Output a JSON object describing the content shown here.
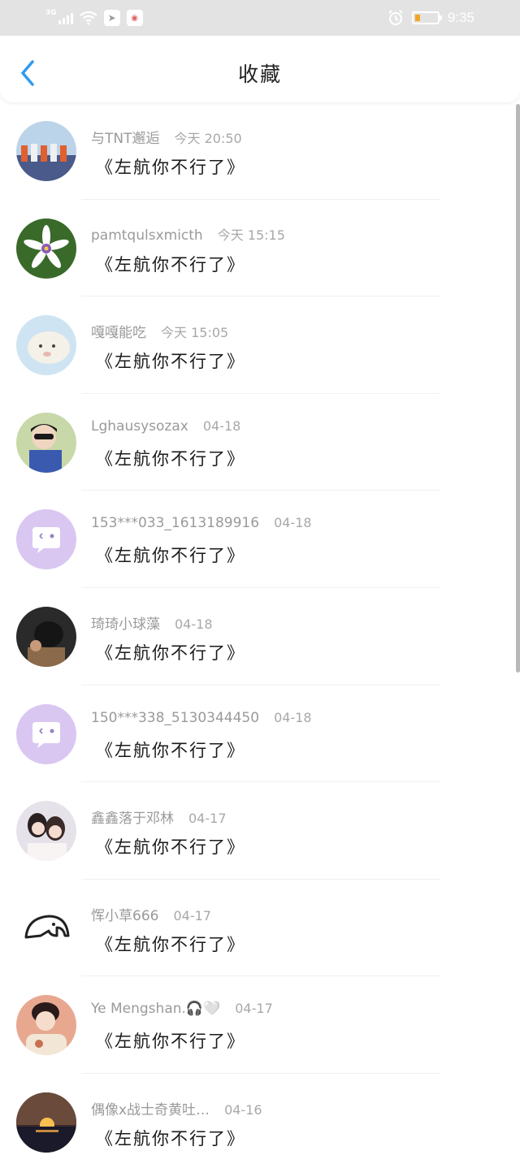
{
  "status_bar": {
    "network_label": "3G",
    "time": "9:35",
    "battery_color": "#f0a623"
  },
  "header": {
    "title": "收藏",
    "back_icon": "chevron-left-icon",
    "accent_color": "#2f9bf0"
  },
  "favorites": [
    {
      "user": "与TNT邂逅",
      "time": "今天 20:50",
      "content": "《左航你不行了》",
      "avatar": "group-photo"
    },
    {
      "user": "pamtqulsxmicth",
      "time": "今天 15:15",
      "content": "《左航你不行了》",
      "avatar": "flower"
    },
    {
      "user": "嘎嘎能吃",
      "time": "今天 15:05",
      "content": "《左航你不行了》",
      "avatar": "lamb"
    },
    {
      "user": "Lghausysozax",
      "time": "04-18",
      "content": "《左航你不行了》",
      "avatar": "boy-sunglasses"
    },
    {
      "user": "153***033_1613189916",
      "time": "04-18",
      "content": "《左航你不行了》",
      "avatar": "default-chat"
    },
    {
      "user": "琦琦小球藻",
      "time": "04-18",
      "content": "《左航你不行了》",
      "avatar": "dark-portrait"
    },
    {
      "user": "150***338_5130344450",
      "time": "04-18",
      "content": "《左航你不行了》",
      "avatar": "default-chat"
    },
    {
      "user": "鑫鑫落于邓林",
      "time": "04-17",
      "content": "《左航你不行了》",
      "avatar": "two-girls"
    },
    {
      "user": "恽小草666",
      "time": "04-17",
      "content": "《左航你不行了》",
      "avatar": "elephant-line"
    },
    {
      "user": "Ye Mengshan.🎧🤍",
      "time": "04-17",
      "content": "《左航你不行了》",
      "avatar": "boy-portrait"
    },
    {
      "user": "偶像x战士奇黄吐…",
      "time": "04-16",
      "content": "《左航你不行了》",
      "avatar": "sunset"
    }
  ]
}
